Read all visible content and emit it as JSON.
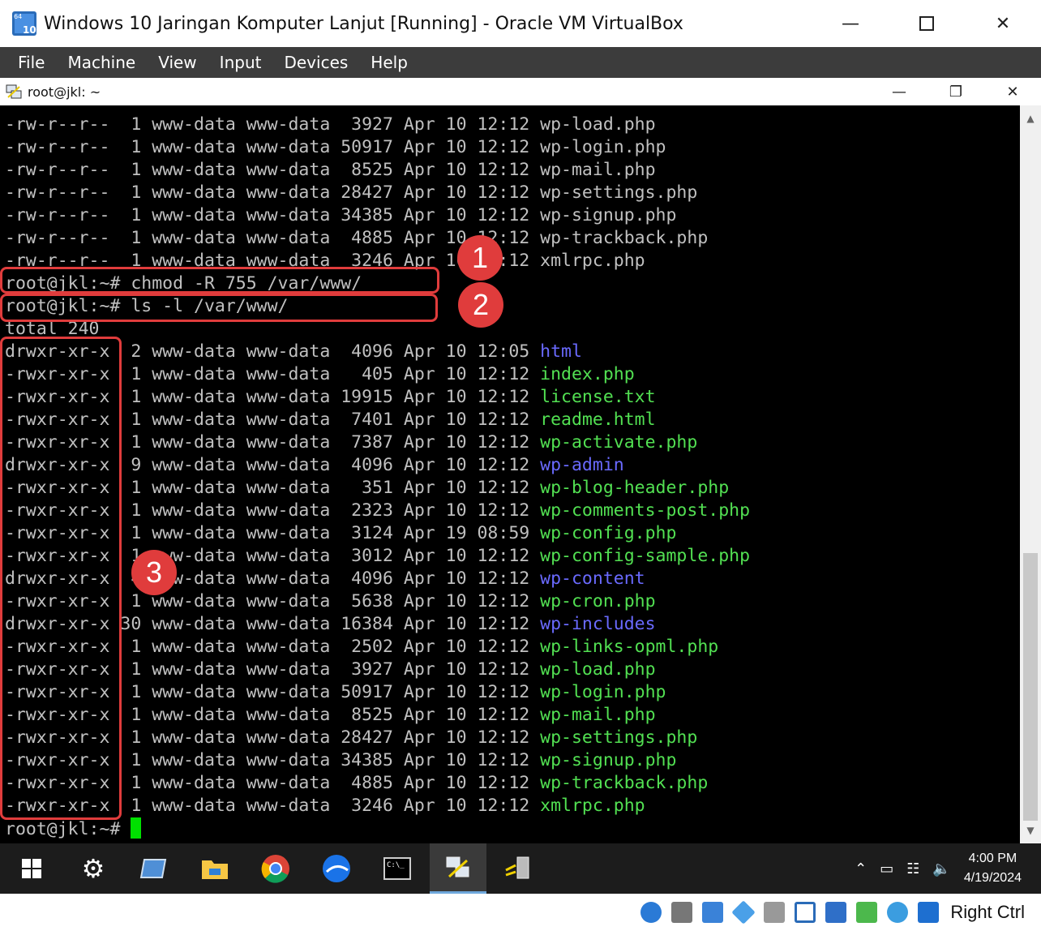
{
  "window": {
    "title": "Windows 10 Jaringan Komputer Lanjut [Running] - Oracle VM VirtualBox",
    "icon_badges": [
      "64",
      "10"
    ]
  },
  "menu": [
    "File",
    "Machine",
    "View",
    "Input",
    "Devices",
    "Help"
  ],
  "guest_window": {
    "title": "root@jkl: ~"
  },
  "terminal": {
    "lines_before": [
      {
        "perms": "-rw-r--r--",
        "links": " 1",
        "owner": "www-data",
        "group": "www-data",
        "size": " 3927",
        "month": "Apr",
        "day": "10",
        "time": "12:12",
        "name": "wp-load.php",
        "is_dir": false
      },
      {
        "perms": "-rw-r--r--",
        "links": " 1",
        "owner": "www-data",
        "group": "www-data",
        "size": "50917",
        "month": "Apr",
        "day": "10",
        "time": "12:12",
        "name": "wp-login.php",
        "is_dir": false
      },
      {
        "perms": "-rw-r--r--",
        "links": " 1",
        "owner": "www-data",
        "group": "www-data",
        "size": " 8525",
        "month": "Apr",
        "day": "10",
        "time": "12:12",
        "name": "wp-mail.php",
        "is_dir": false
      },
      {
        "perms": "-rw-r--r--",
        "links": " 1",
        "owner": "www-data",
        "group": "www-data",
        "size": "28427",
        "month": "Apr",
        "day": "10",
        "time": "12:12",
        "name": "wp-settings.php",
        "is_dir": false
      },
      {
        "perms": "-rw-r--r--",
        "links": " 1",
        "owner": "www-data",
        "group": "www-data",
        "size": "34385",
        "month": "Apr",
        "day": "10",
        "time": "12:12",
        "name": "wp-signup.php",
        "is_dir": false
      },
      {
        "perms": "-rw-r--r--",
        "links": " 1",
        "owner": "www-data",
        "group": "www-data",
        "size": " 4885",
        "month": "Apr",
        "day": "10",
        "time": "12:12",
        "name": "wp-trackback.php",
        "is_dir": false
      },
      {
        "perms": "-rw-r--r--",
        "links": " 1",
        "owner": "www-data",
        "group": "www-data",
        "size": " 3246",
        "month": "Apr",
        "day": "10",
        "time": "12:12",
        "name": "xmlrpc.php",
        "is_dir": false
      }
    ],
    "command1": "root@jkl:~# chmod -R 755 /var/www/",
    "command2": "root@jkl:~# ls -l /var/www/",
    "total": "total 240",
    "lines_after": [
      {
        "perms": "drwxr-xr-x",
        "links": " 2",
        "owner": "www-data",
        "group": "www-data",
        "size": " 4096",
        "month": "Apr",
        "day": "10",
        "time": "12:05",
        "name": "html",
        "is_dir": true
      },
      {
        "perms": "-rwxr-xr-x",
        "links": " 1",
        "owner": "www-data",
        "group": "www-data",
        "size": "  405",
        "month": "Apr",
        "day": "10",
        "time": "12:12",
        "name": "index.php",
        "is_dir": false
      },
      {
        "perms": "-rwxr-xr-x",
        "links": " 1",
        "owner": "www-data",
        "group": "www-data",
        "size": "19915",
        "month": "Apr",
        "day": "10",
        "time": "12:12",
        "name": "license.txt",
        "is_dir": false
      },
      {
        "perms": "-rwxr-xr-x",
        "links": " 1",
        "owner": "www-data",
        "group": "www-data",
        "size": " 7401",
        "month": "Apr",
        "day": "10",
        "time": "12:12",
        "name": "readme.html",
        "is_dir": false
      },
      {
        "perms": "-rwxr-xr-x",
        "links": " 1",
        "owner": "www-data",
        "group": "www-data",
        "size": " 7387",
        "month": "Apr",
        "day": "10",
        "time": "12:12",
        "name": "wp-activate.php",
        "is_dir": false
      },
      {
        "perms": "drwxr-xr-x",
        "links": " 9",
        "owner": "www-data",
        "group": "www-data",
        "size": " 4096",
        "month": "Apr",
        "day": "10",
        "time": "12:12",
        "name": "wp-admin",
        "is_dir": true
      },
      {
        "perms": "-rwxr-xr-x",
        "links": " 1",
        "owner": "www-data",
        "group": "www-data",
        "size": "  351",
        "month": "Apr",
        "day": "10",
        "time": "12:12",
        "name": "wp-blog-header.php",
        "is_dir": false
      },
      {
        "perms": "-rwxr-xr-x",
        "links": " 1",
        "owner": "www-data",
        "group": "www-data",
        "size": " 2323",
        "month": "Apr",
        "day": "10",
        "time": "12:12",
        "name": "wp-comments-post.php",
        "is_dir": false
      },
      {
        "perms": "-rwxr-xr-x",
        "links": " 1",
        "owner": "www-data",
        "group": "www-data",
        "size": " 3124",
        "month": "Apr",
        "day": "19",
        "time": "08:59",
        "name": "wp-config.php",
        "is_dir": false
      },
      {
        "perms": "-rwxr-xr-x",
        "links": " 1",
        "owner": "www-data",
        "group": "www-data",
        "size": " 3012",
        "month": "Apr",
        "day": "10",
        "time": "12:12",
        "name": "wp-config-sample.php",
        "is_dir": false
      },
      {
        "perms": "drwxr-xr-x",
        "links": " 4",
        "owner": "www-data",
        "group": "www-data",
        "size": " 4096",
        "month": "Apr",
        "day": "10",
        "time": "12:12",
        "name": "wp-content",
        "is_dir": true
      },
      {
        "perms": "-rwxr-xr-x",
        "links": " 1",
        "owner": "www-data",
        "group": "www-data",
        "size": " 5638",
        "month": "Apr",
        "day": "10",
        "time": "12:12",
        "name": "wp-cron.php",
        "is_dir": false
      },
      {
        "perms": "drwxr-xr-x",
        "links": "30",
        "owner": "www-data",
        "group": "www-data",
        "size": "16384",
        "month": "Apr",
        "day": "10",
        "time": "12:12",
        "name": "wp-includes",
        "is_dir": true
      },
      {
        "perms": "-rwxr-xr-x",
        "links": " 1",
        "owner": "www-data",
        "group": "www-data",
        "size": " 2502",
        "month": "Apr",
        "day": "10",
        "time": "12:12",
        "name": "wp-links-opml.php",
        "is_dir": false
      },
      {
        "perms": "-rwxr-xr-x",
        "links": " 1",
        "owner": "www-data",
        "group": "www-data",
        "size": " 3927",
        "month": "Apr",
        "day": "10",
        "time": "12:12",
        "name": "wp-load.php",
        "is_dir": false
      },
      {
        "perms": "-rwxr-xr-x",
        "links": " 1",
        "owner": "www-data",
        "group": "www-data",
        "size": "50917",
        "month": "Apr",
        "day": "10",
        "time": "12:12",
        "name": "wp-login.php",
        "is_dir": false
      },
      {
        "perms": "-rwxr-xr-x",
        "links": " 1",
        "owner": "www-data",
        "group": "www-data",
        "size": " 8525",
        "month": "Apr",
        "day": "10",
        "time": "12:12",
        "name": "wp-mail.php",
        "is_dir": false
      },
      {
        "perms": "-rwxr-xr-x",
        "links": " 1",
        "owner": "www-data",
        "group": "www-data",
        "size": "28427",
        "month": "Apr",
        "day": "10",
        "time": "12:12",
        "name": "wp-settings.php",
        "is_dir": false
      },
      {
        "perms": "-rwxr-xr-x",
        "links": " 1",
        "owner": "www-data",
        "group": "www-data",
        "size": "34385",
        "month": "Apr",
        "day": "10",
        "time": "12:12",
        "name": "wp-signup.php",
        "is_dir": false
      },
      {
        "perms": "-rwxr-xr-x",
        "links": " 1",
        "owner": "www-data",
        "group": "www-data",
        "size": " 4885",
        "month": "Apr",
        "day": "10",
        "time": "12:12",
        "name": "wp-trackback.php",
        "is_dir": false
      },
      {
        "perms": "-rwxr-xr-x",
        "links": " 1",
        "owner": "www-data",
        "group": "www-data",
        "size": " 3246",
        "month": "Apr",
        "day": "10",
        "time": "12:12",
        "name": "xmlrpc.php",
        "is_dir": false
      }
    ],
    "prompt": "root@jkl:~# ",
    "colors": {
      "file": "#52e052",
      "dir": "#6a6aff",
      "text": "#c0c0c0",
      "background": "#000000",
      "cursor": "#00e000"
    }
  },
  "annotations": {
    "labels": [
      "1",
      "2",
      "3"
    ],
    "color": "#e03c3c"
  },
  "taskbar": {
    "apps": [
      "start-icon",
      "settings-icon",
      "vmware-icon",
      "file-explorer-icon",
      "chrome-icon",
      "browser-icon",
      "terminal-icon",
      "putty-icon",
      "network-tool-icon"
    ],
    "clock_time": "4:00 PM",
    "clock_date": "4/19/2024"
  },
  "status_bar": {
    "host_key": "Right Ctrl"
  }
}
